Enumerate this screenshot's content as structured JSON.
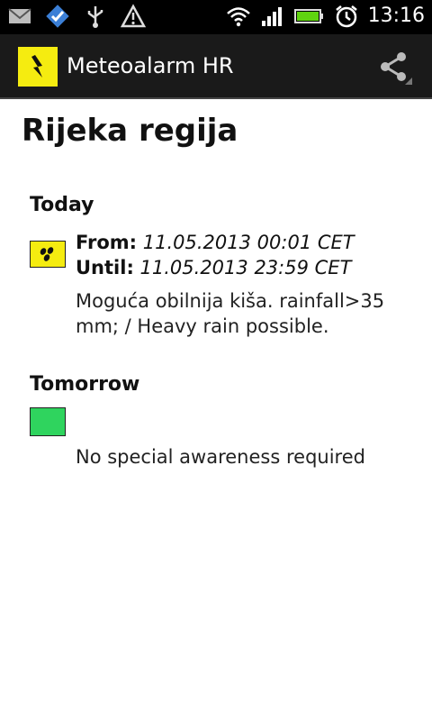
{
  "status_bar": {
    "time": "13:16",
    "icons": [
      "gmail-icon",
      "check-app-icon",
      "usb-icon",
      "warning-icon",
      "wifi-icon",
      "signal-icon",
      "battery-icon",
      "alarm-icon"
    ]
  },
  "action_bar": {
    "title": "Meteoalarm HR",
    "logo_color": "#f5ec10",
    "share_icon": "share-icon"
  },
  "region": {
    "title": "Rijeka regija"
  },
  "today": {
    "label": "Today",
    "icon_color": "#f5ec10",
    "from_label": "From:",
    "from_value": "11.05.2013 00:01 CET",
    "until_label": "Until:",
    "until_value": "11.05.2013 23:59 CET",
    "description": "Moguća obilnija kiša. rainfall>35 mm; / Heavy rain possible."
  },
  "tomorrow": {
    "label": "Tomorrow",
    "icon_color": "#2fd45e",
    "description": "No special awareness required"
  }
}
